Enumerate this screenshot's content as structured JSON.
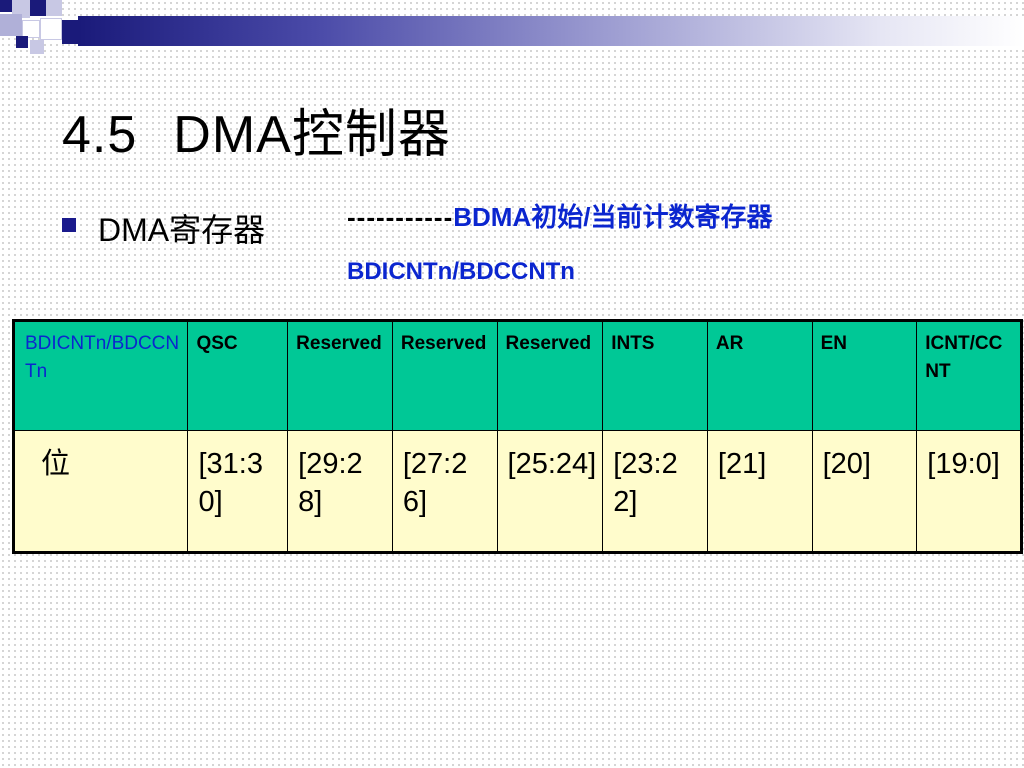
{
  "slide": {
    "title_num": "4.5",
    "title_text": "DMA控制器",
    "bullet": "DMA寄存器",
    "subtitle_dashes": "-----------",
    "subtitle_label": "BDMA初始/当前计数寄存器",
    "subtitle_reg": "BDICNTn/BDCCNTn"
  },
  "colors": {
    "accent_blue": "#0b26cf",
    "header_green": "#00c896",
    "body_yellow": "#fffccc",
    "bar_navy": "#1a1a7a"
  },
  "table": {
    "headers": [
      "BDICNTn/BDCCNTn",
      "QSC",
      "Reserved",
      "Reserved",
      "Reserved",
      "INTS",
      "AR",
      "EN",
      "ICNT/CCNT"
    ],
    "row": [
      "位",
      "[31:30]",
      "[29:28]",
      "[27:26]",
      "[25:24]",
      "[23:22]",
      "[21]",
      "[20]",
      "[19:0]"
    ]
  }
}
